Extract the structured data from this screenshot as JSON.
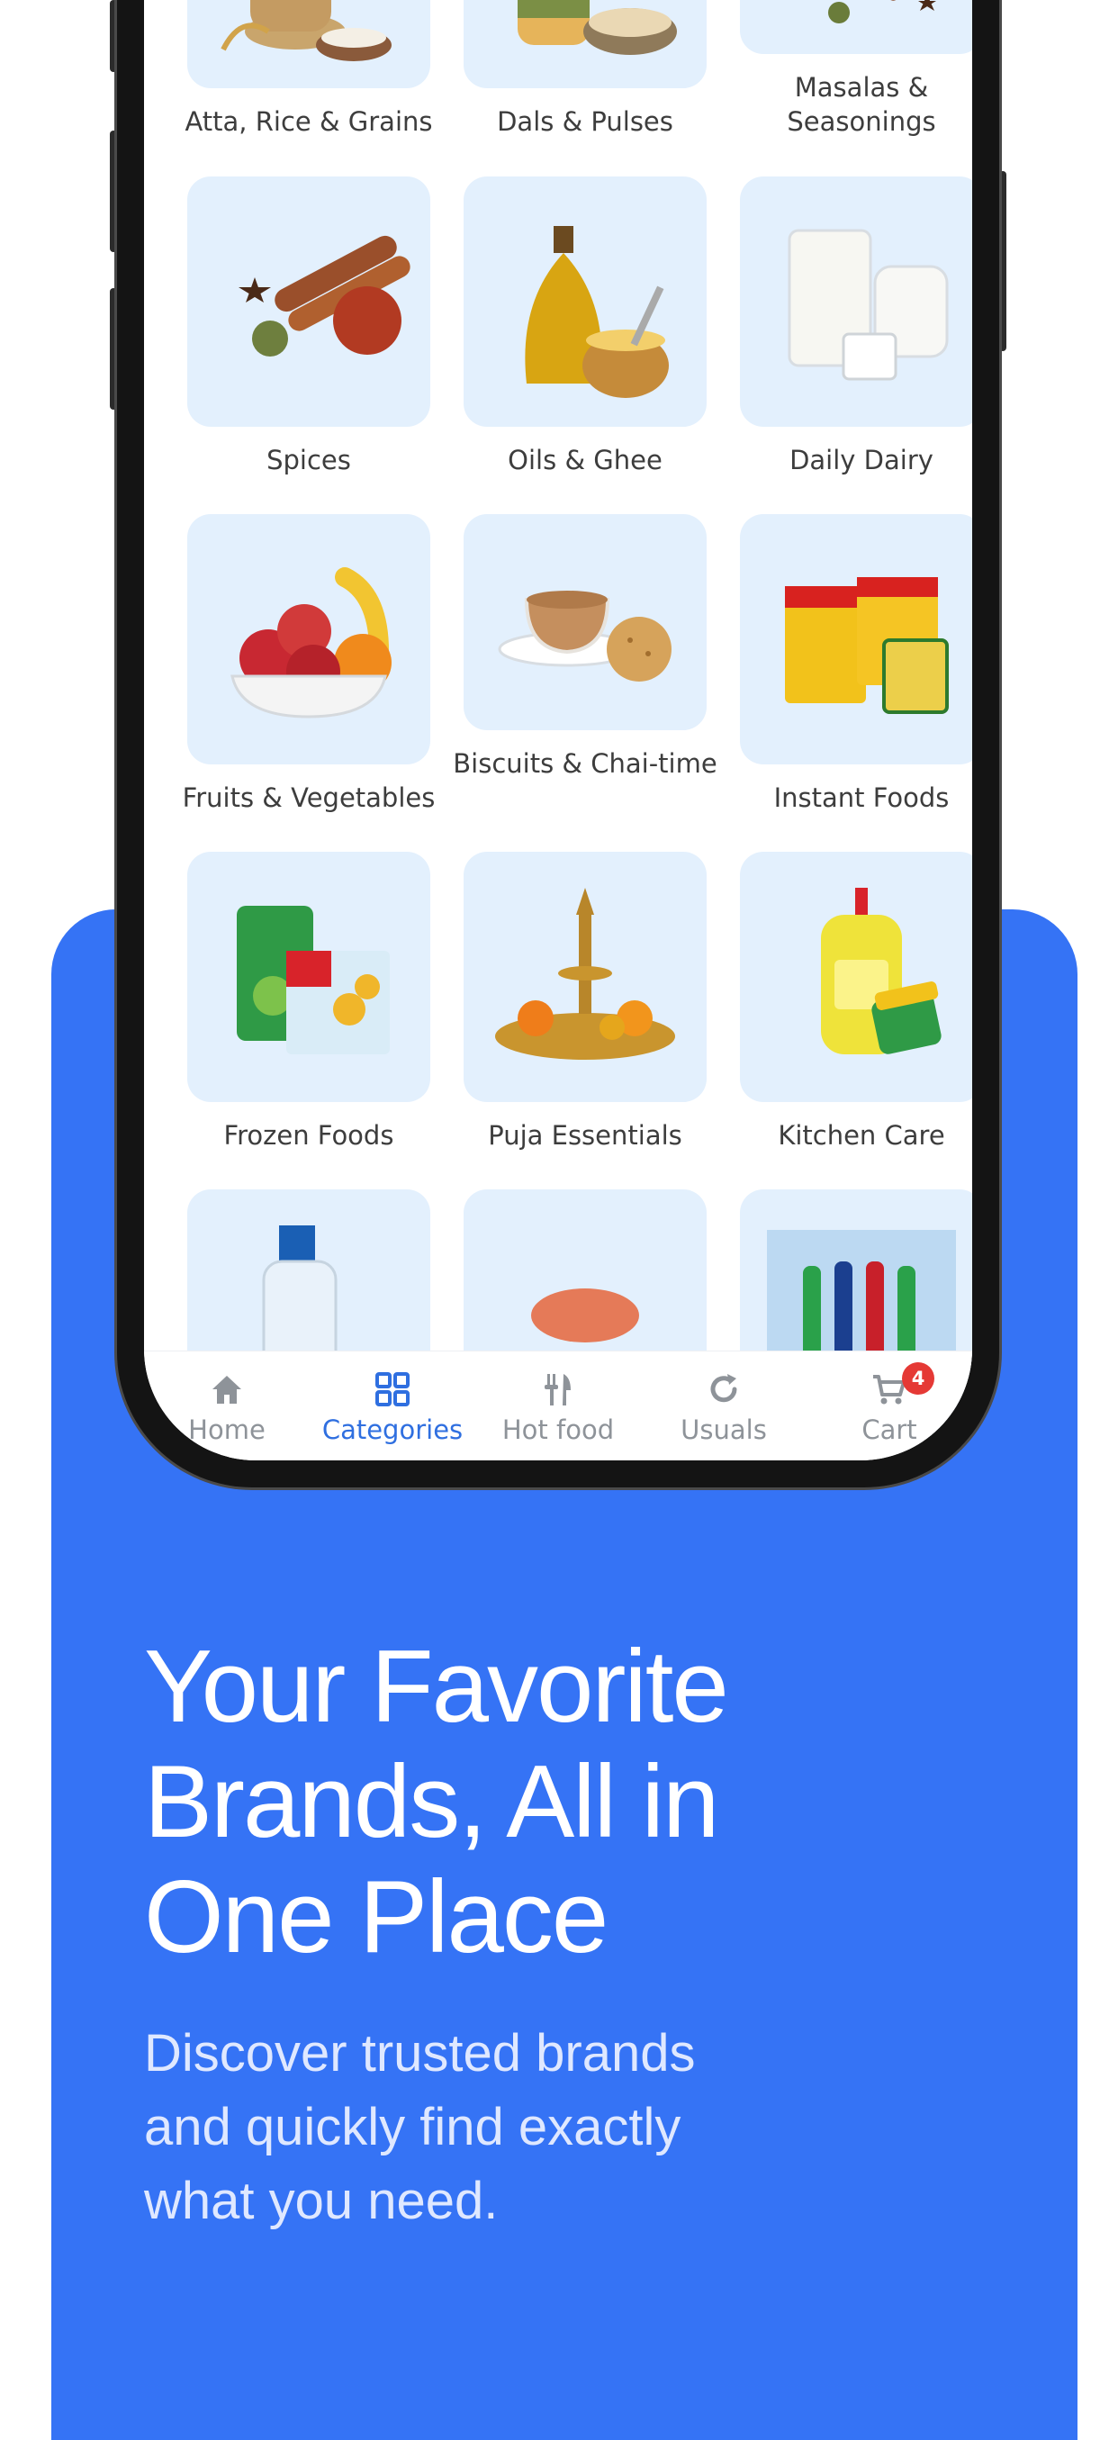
{
  "categories": [
    {
      "label": "Atta, Rice & Grains",
      "icon": "grain-sack-icon"
    },
    {
      "label": "Dals & Pulses",
      "icon": "pulses-jar-icon"
    },
    {
      "label": "Masalas & Seasonings",
      "icon": "masala-bowl-icon"
    },
    {
      "label": "Spices",
      "icon": "cinnamon-star-anise-icon"
    },
    {
      "label": "Oils & Ghee",
      "icon": "oil-bottle-ghee-icon"
    },
    {
      "label": "Daily Dairy",
      "icon": "milk-glass-yogurt-icon"
    },
    {
      "label": "Fruits & Vegetables",
      "icon": "fruit-bowl-icon"
    },
    {
      "label": "Biscuits & Chai-time",
      "icon": "tea-cup-biscuit-icon"
    },
    {
      "label": "Instant Foods",
      "icon": "noodle-packets-icon"
    },
    {
      "label": "Frozen Foods",
      "icon": "frozen-packets-icon"
    },
    {
      "label": "Puja Essentials",
      "icon": "diya-lamp-icon"
    },
    {
      "label": "Kitchen Care",
      "icon": "dish-soap-sponge-icon"
    }
  ],
  "nav": {
    "home": "Home",
    "categories": "Categories",
    "hot_food": "Hot food",
    "usuals": "Usuals",
    "cart": "Cart",
    "cart_count": "4",
    "active": "Categories"
  },
  "promo": {
    "headline_line1": "Your Favorite",
    "headline_line2": "Brands, All in",
    "headline_line3": "One Place",
    "subtext_line1": "Discover trusted brands",
    "subtext_line2": "and quickly find exactly",
    "subtext_line3": "what you need."
  },
  "colors": {
    "panel_blue": "#3573f5",
    "tile_bg": "#e3f0fd",
    "nav_active": "#2f6fe0",
    "badge_red": "#e53935"
  }
}
